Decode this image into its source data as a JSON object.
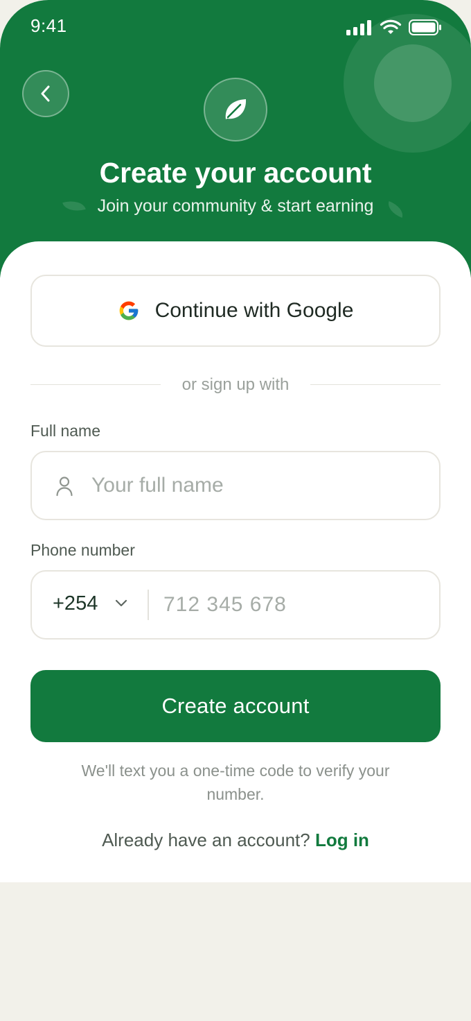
{
  "status_bar": {
    "time": "9:41"
  },
  "header": {
    "title": "Create your account",
    "subtitle": "Join your community & start earning",
    "icons": {
      "back": "chevron-left-icon",
      "logo": "leaf-icon"
    }
  },
  "google_button": {
    "label": "Continue with Google",
    "icon": "google-icon"
  },
  "divider": {
    "label": "or sign up with"
  },
  "full_name": {
    "label": "Full name",
    "placeholder": "Your full name",
    "value": "",
    "icon": "person-icon"
  },
  "phone": {
    "label": "Phone number",
    "country_code": "+254",
    "placeholder": "712 345 678",
    "value": ""
  },
  "create_button": {
    "label": "Create account"
  },
  "helper": {
    "text": "We'll text you a one-time code to verify your number."
  },
  "login_prompt": {
    "text": "Already have an account?",
    "link": "Log in"
  },
  "colors": {
    "brand": "#127a3e",
    "background": "#f2f1ea",
    "border": "#e7e5de"
  }
}
